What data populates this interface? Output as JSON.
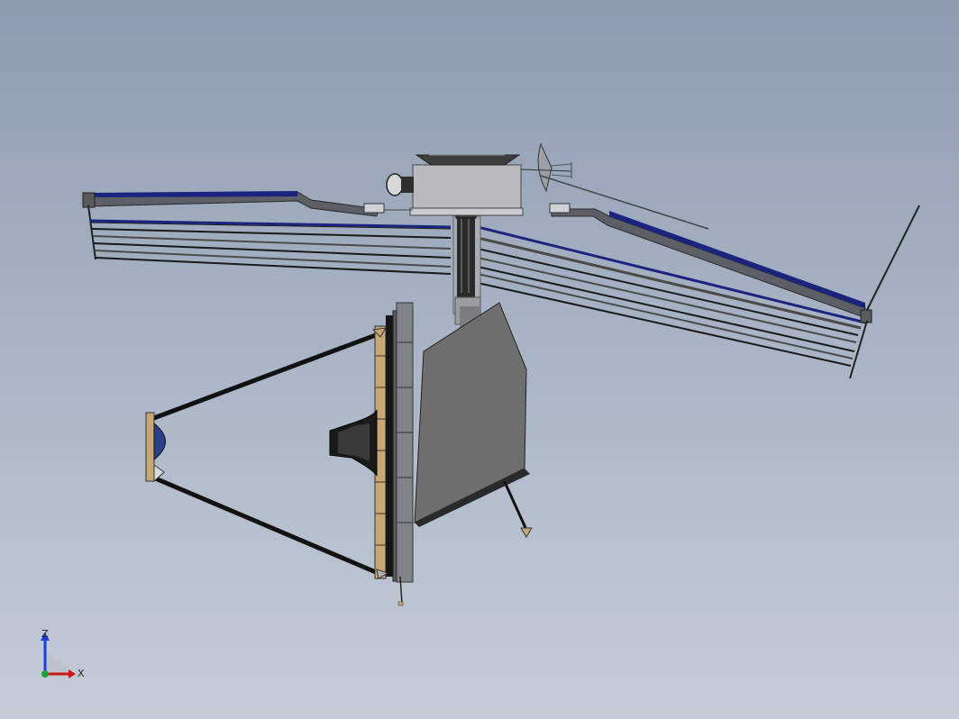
{
  "viewport": {
    "model": "telescope-satellite-assembly",
    "background_top": "#8d9cb0",
    "background_bottom": "#c5ccd7",
    "colors": {
      "body_gray": "#6b6b6b",
      "light_gray": "#b5b8bb",
      "panel_blue": "#1a237e",
      "dark": "#1a1a1a",
      "tan": "#c8a777"
    }
  },
  "triad": {
    "z_label": "Z",
    "x_label": "X",
    "z_color": "#1c3fd6",
    "x_color": "#cc1a1a",
    "origin_color": "#1e9e3a"
  }
}
